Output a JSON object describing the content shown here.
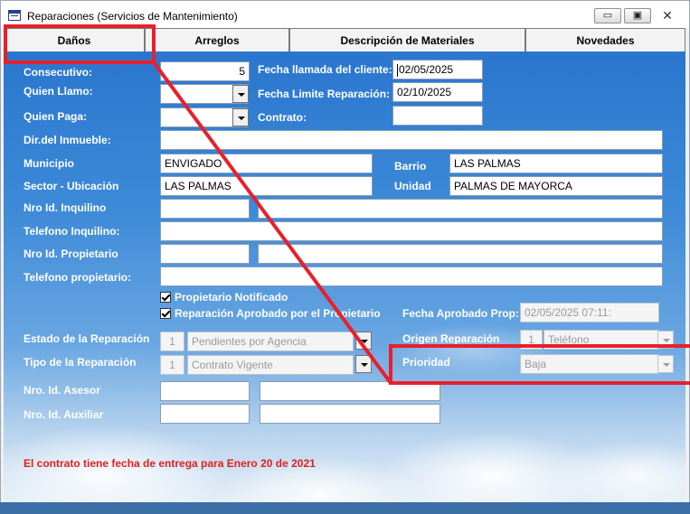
{
  "window": {
    "title": "Reparaciones (Servicios de Mantenimiento)",
    "minimize_glyph": "▭",
    "maximize_glyph": "▣",
    "close_glyph": "✕"
  },
  "tabs": [
    {
      "label": "Daños",
      "active": true
    },
    {
      "label": "Arreglos",
      "active": false
    },
    {
      "label": "Descripción de Materiales",
      "active": false
    },
    {
      "label": "Novedades",
      "active": false
    }
  ],
  "form": {
    "consecutivo": {
      "label": "Consecutivo:",
      "value": "5"
    },
    "quien_llamo": {
      "label": "Quien Llamo:",
      "value": ""
    },
    "quien_paga": {
      "label": "Quien Paga:",
      "value": ""
    },
    "fecha_llamada": {
      "label": "Fecha llamada del cliente:",
      "value": "02/05/2025"
    },
    "fecha_limite": {
      "label": "Fecha Limite Reparación:",
      "value": "02/10/2025"
    },
    "contrato": {
      "label": "Contrato:",
      "value": ""
    },
    "dir_inmueble": {
      "label": "Dir.del Inmueble:",
      "value": ""
    },
    "municipio": {
      "label": "Municipio",
      "value": "ENVIGADO"
    },
    "barrio": {
      "label": "Barrio",
      "value": "LAS PALMAS"
    },
    "sector": {
      "label": "Sector - Ubicación",
      "value": "LAS PALMAS"
    },
    "unidad": {
      "label": "Unidad",
      "value": "PALMAS DE MAYORCA"
    },
    "nro_inquilino": {
      "label": "Nro Id. Inquilino",
      "id": "",
      "name": ""
    },
    "tel_inquilino": {
      "label": "Telefono Inquilino:",
      "value": ""
    },
    "nro_propietario": {
      "label": "Nro Id. Propietario",
      "id": "",
      "name": ""
    },
    "tel_propietario": {
      "label": "Telefono propietario:",
      "value": ""
    },
    "propietario_notificado": {
      "label": "Propietario Notificado",
      "checked": true
    },
    "reparacion_aprobada": {
      "label": "Reparación Aprobado por el Propietario",
      "checked": true
    },
    "fecha_aprobado": {
      "label": "Fecha Aprobado Prop:",
      "value": "02/05/2025 07:11:"
    },
    "estado": {
      "label": "Estado de la Reparación",
      "code": "1",
      "value": "Pendientes por Agencia"
    },
    "tipo": {
      "label": "Tipo de la Reparación",
      "code": "1",
      "value": "Contrato Vigente"
    },
    "origen": {
      "label": "Origen Reparación",
      "code": "1",
      "value": "Teléfono"
    },
    "prioridad": {
      "label": "Prioridad",
      "value": "Baja"
    },
    "nro_asesor": {
      "label": "Nro. Id. Asesor",
      "id": "",
      "name": ""
    },
    "nro_auxiliar": {
      "label": "Nro. Id. Auxiliar",
      "id": "",
      "name": ""
    }
  },
  "notice": "El contrato tiene fecha de entrega para Enero 20 de 2021",
  "colors": {
    "highlight": "#e8202a",
    "label": "#ffffff",
    "notice": "#e0201c"
  }
}
